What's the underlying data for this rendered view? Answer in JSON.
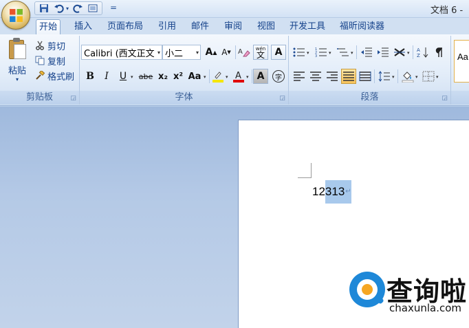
{
  "window": {
    "title": "文档 6 -"
  },
  "quick_access": {
    "save": "save-icon",
    "undo": "undo-icon",
    "redo": "redo-icon",
    "print_preview": "print-preview-icon",
    "customize": "="
  },
  "tabs": [
    {
      "label": "开始",
      "active": true
    },
    {
      "label": "插入"
    },
    {
      "label": "页面布局"
    },
    {
      "label": "引用"
    },
    {
      "label": "邮件"
    },
    {
      "label": "审阅"
    },
    {
      "label": "视图"
    },
    {
      "label": "开发工具"
    },
    {
      "label": "福昕阅读器"
    }
  ],
  "clipboard": {
    "group_label": "剪贴板",
    "paste": "粘贴",
    "cut": "剪切",
    "copy": "复制",
    "format_painter": "格式刷"
  },
  "font": {
    "group_label": "字体",
    "font_name": "Calibri (西文正文",
    "font_size": "小二",
    "grow": "A",
    "shrink": "A",
    "bold": "B",
    "italic": "I",
    "underline": "U",
    "strike": "abe",
    "subscript": "x₂",
    "superscript": "x²",
    "change_case": "Aa",
    "phonetic": "wén",
    "char_border": "A",
    "char_shading": "A",
    "enclose": "字",
    "highlight_color": "#f5e600",
    "font_color": "#e00000"
  },
  "paragraph": {
    "group_label": "段落"
  },
  "styles": {
    "preview": "Aa"
  },
  "document": {
    "text_plain": "12",
    "text_selected": "313",
    "paragraph_mark": "↵"
  },
  "watermark": {
    "cn": "查询啦",
    "en": "chaxunla.com"
  },
  "colors": {
    "ribbon_text": "#15428b",
    "selection": "#a8c9ec",
    "accent_blue": "#1e88d8",
    "accent_orange": "#f5a623"
  }
}
